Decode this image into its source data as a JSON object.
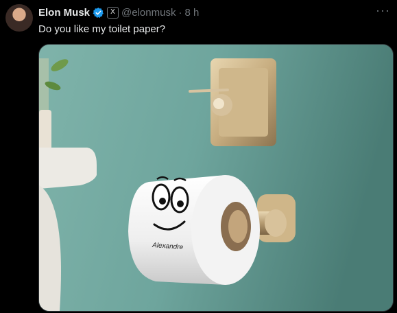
{
  "tweet": {
    "author_name": "Elon Musk",
    "handle": "@elonmusk",
    "separator": "·",
    "time": "8 h",
    "x_badge": "X",
    "more_glyph": "···",
    "text": "Do you like my toilet paper?",
    "verified_color": "#1d9bf0"
  },
  "media": {
    "roll_name": "Alexandre"
  }
}
